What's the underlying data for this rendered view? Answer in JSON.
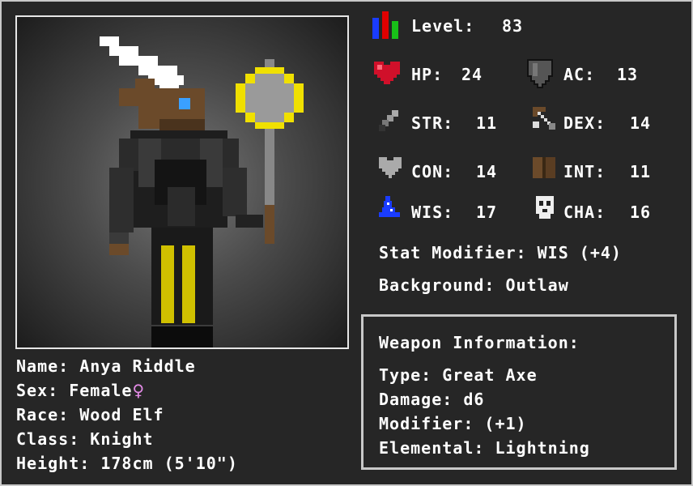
{
  "level": {
    "label": "Level:",
    "value": "83"
  },
  "stats": [
    {
      "key": "hp",
      "label": "HP:",
      "value": "24",
      "icon": "heart-icon"
    },
    {
      "key": "ac",
      "label": "AC:",
      "value": "13",
      "icon": "shield-icon"
    },
    {
      "key": "str",
      "label": "STR:",
      "value": "11",
      "icon": "sword-icon"
    },
    {
      "key": "dex",
      "label": "DEX:",
      "value": "14",
      "icon": "bow-icon"
    },
    {
      "key": "con",
      "label": "CON:",
      "value": "14",
      "icon": "gray-heart-icon"
    },
    {
      "key": "int",
      "label": "INT:",
      "value": "11",
      "icon": "book-icon"
    },
    {
      "key": "wis",
      "label": "WIS:",
      "value": "17",
      "icon": "wizard-hat-icon"
    },
    {
      "key": "cha",
      "label": "CHA:",
      "value": "16",
      "icon": "mask-icon"
    }
  ],
  "stat_modifier": "Stat Modifier: WIS (+4)",
  "background": "Background: Outlaw",
  "character": {
    "name": "Name: Anya Riddle",
    "sex": "Sex: Female",
    "sex_symbol": "♀",
    "race": "Race: Wood Elf",
    "class": "Class: Knight",
    "height": "Height: 178cm (5'10\")"
  },
  "weapon": {
    "title": "Weapon Information:",
    "type": "Type: Great Axe",
    "damage": "Damage: d6",
    "modifier": "Modifier: (+1)",
    "elemental": "Elemental: Lightning"
  },
  "colors": {
    "background": "#262626",
    "frame": "#c8c8c8",
    "female_symbol": "#e38be6",
    "heart": "#d0102a",
    "level_bars": [
      "#1a3cff",
      "#e00000",
      "#18c018"
    ]
  }
}
